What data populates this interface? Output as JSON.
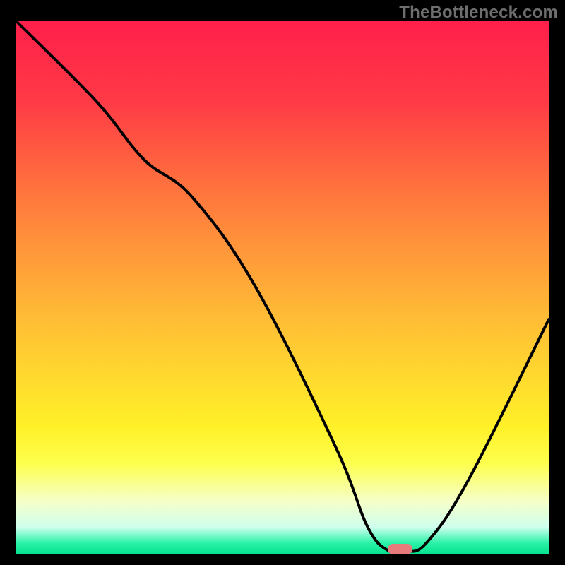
{
  "watermark": "TheBottleneck.com",
  "chart_data": {
    "type": "line",
    "title": "",
    "xlabel": "",
    "ylabel": "",
    "xlim": [
      0,
      100
    ],
    "ylim": [
      0,
      100
    ],
    "x": [
      0,
      15,
      24,
      33,
      45,
      60,
      66,
      70,
      73,
      77,
      85,
      100
    ],
    "values": [
      100,
      85,
      74,
      67,
      50,
      20,
      5,
      0.5,
      0.5,
      2,
      14,
      44
    ],
    "marker": {
      "x": 72,
      "y": 0.8
    },
    "background_gradient": [
      {
        "pos": 0,
        "color": "#ff1f4b"
      },
      {
        "pos": 30,
        "color": "#ff6e3e"
      },
      {
        "pos": 55,
        "color": "#ffba36"
      },
      {
        "pos": 76,
        "color": "#fff028"
      },
      {
        "pos": 90,
        "color": "#f6ffc6"
      },
      {
        "pos": 100,
        "color": "#06e38f"
      }
    ]
  }
}
